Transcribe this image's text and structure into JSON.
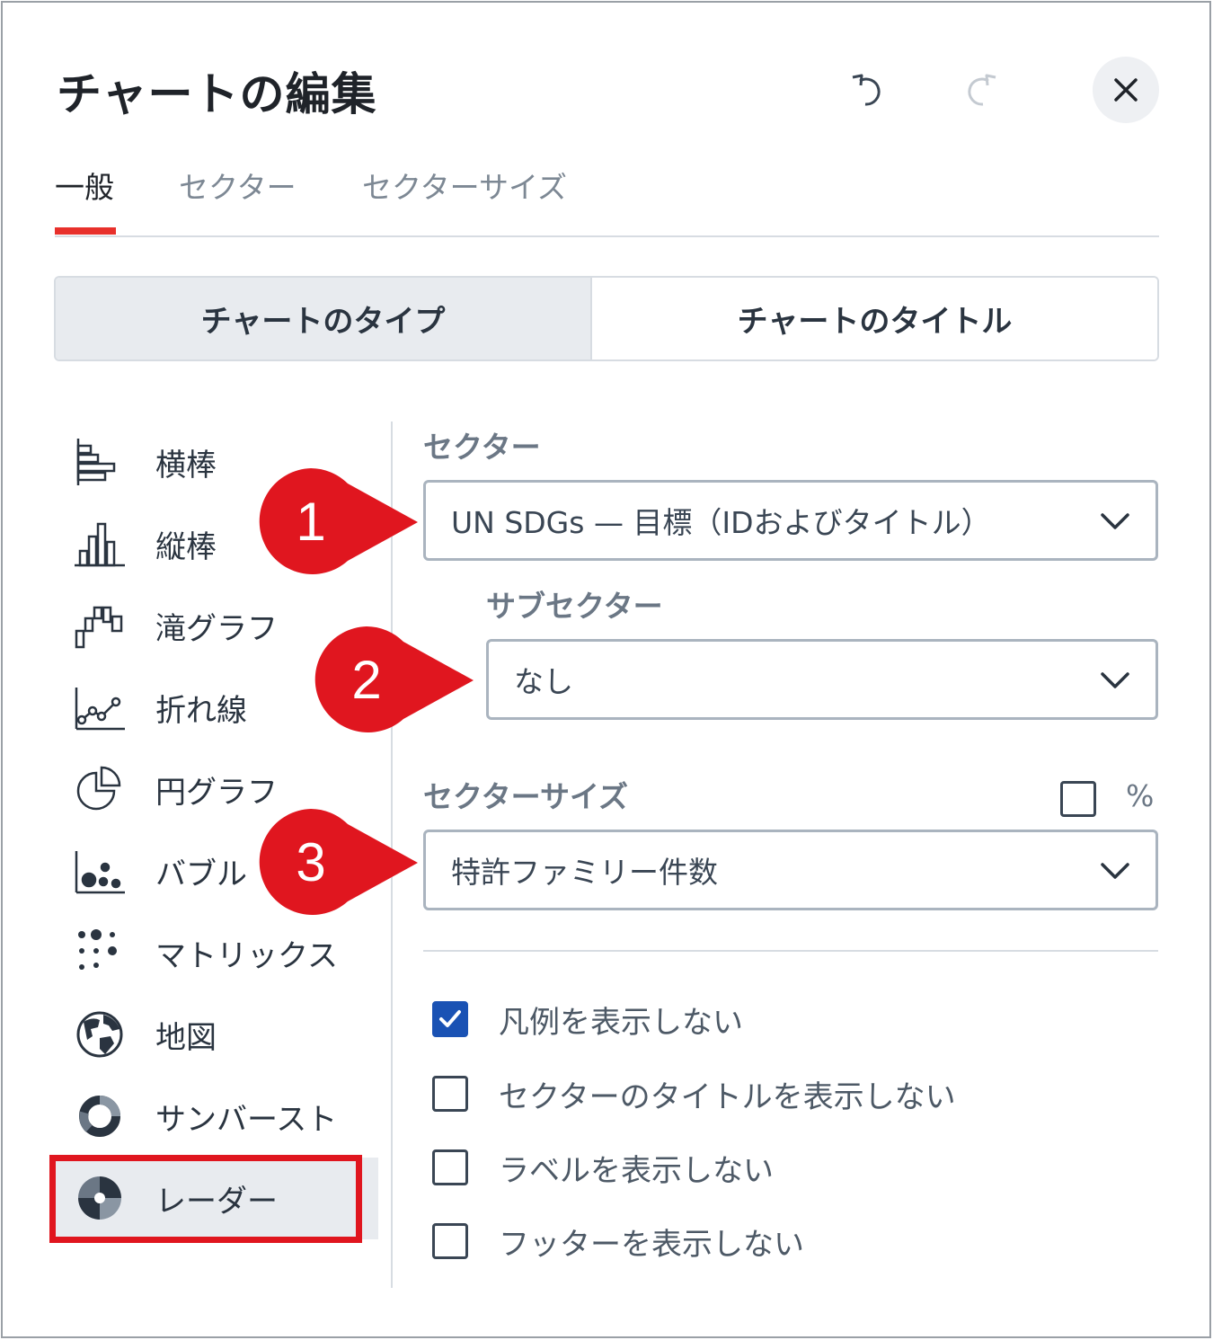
{
  "dialog": {
    "title": "チャートの編集"
  },
  "tabs": [
    {
      "label": "一般",
      "active": true
    },
    {
      "label": "セクター",
      "active": false
    },
    {
      "label": "セクターサイズ",
      "active": false
    }
  ],
  "segmented": {
    "left": "チャートのタイプ",
    "right": "チャートのタイトル",
    "selected": "left"
  },
  "chart_types": [
    {
      "label": "横棒",
      "icon": "horizontal-bar-icon"
    },
    {
      "label": "縦棒",
      "icon": "vertical-bar-icon"
    },
    {
      "label": "滝グラフ",
      "icon": "waterfall-icon"
    },
    {
      "label": "折れ線",
      "icon": "line-chart-icon"
    },
    {
      "label": "円グラフ",
      "icon": "pie-chart-icon"
    },
    {
      "label": "バブル",
      "icon": "bubble-chart-icon"
    },
    {
      "label": "マトリックス",
      "icon": "matrix-icon"
    },
    {
      "label": "地図",
      "icon": "globe-icon"
    },
    {
      "label": "サンバースト",
      "icon": "sunburst-icon"
    },
    {
      "label": "レーダー",
      "icon": "radar-icon",
      "selected": true
    }
  ],
  "fields": {
    "sector": {
      "label": "セクター",
      "value": "UN SDGs — 目標（IDおよびタイトル）"
    },
    "subsector": {
      "label": "サブセクター",
      "value": "なし"
    },
    "sector_size": {
      "label": "セクターサイズ",
      "value": "特許ファミリー件数",
      "percent_label": "%",
      "percent_checked": false
    }
  },
  "options": [
    {
      "label": "凡例を表示しない",
      "checked": true
    },
    {
      "label": "セクターのタイトルを表示しない",
      "checked": false
    },
    {
      "label": "ラベルを表示しない",
      "checked": false
    },
    {
      "label": "フッターを表示しない",
      "checked": false
    }
  ],
  "callouts": [
    "1",
    "2",
    "3"
  ],
  "colors": {
    "accent": "#e8302b",
    "callout": "#e0161f",
    "checkbox": "#1a52b4"
  }
}
